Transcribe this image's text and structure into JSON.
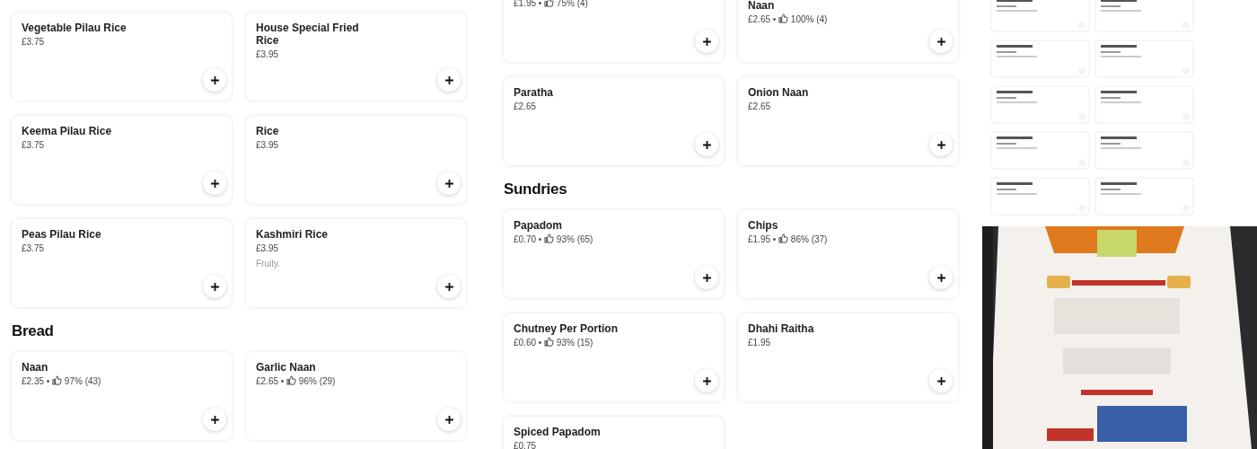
{
  "columns": [
    {
      "sections": [
        {
          "items": [
            {
              "name": "Vegetable Pilau Rice",
              "price": "£3.75"
            },
            {
              "name": "House Special Fried Rice",
              "price": "£3.95"
            },
            {
              "name": "Keema Pilau Rice",
              "price": "£3.75"
            },
            {
              "name": "Rice",
              "price": "£3.95"
            },
            {
              "name": "Peas Pilau Rice",
              "price": "£3.75"
            },
            {
              "name": "Kashmiri Rice",
              "price": "£3.95",
              "description": "Fruity."
            }
          ]
        },
        {
          "heading": "Bread",
          "items": [
            {
              "name": "Naan",
              "price": "£2.35",
              "separator": "•",
              "rating": "97% (43)"
            },
            {
              "name": "Garlic Naan",
              "price": "£2.65",
              "separator": "•",
              "rating": "96% (29)"
            }
          ]
        }
      ]
    },
    {
      "sections": [
        {
          "items": [
            {
              "price": "£1.95",
              "separator": "•",
              "rating": "75% (4)"
            },
            {
              "name": "Naan",
              "price": "£2.65",
              "separator": "•",
              "rating": "100% (4)"
            },
            {
              "name": "Paratha",
              "price": "£2.65"
            },
            {
              "name": "Onion Naan",
              "price": "£2.65"
            }
          ]
        },
        {
          "heading": "Sundries",
          "items": [
            {
              "name": "Papadom",
              "price": "£0.70",
              "separator": "•",
              "rating": "93% (65)"
            },
            {
              "name": "Chips",
              "price": "£1.95",
              "separator": "•",
              "rating": "86% (37)"
            },
            {
              "name": "Chutney Per Portion",
              "price": "£0.60",
              "separator": "•",
              "rating": "93% (15)"
            },
            {
              "name": "Dhahi Raitha",
              "price": "£1.95"
            },
            {
              "name": "Spiced Papadom",
              "price": "£0.75"
            }
          ]
        }
      ]
    }
  ]
}
